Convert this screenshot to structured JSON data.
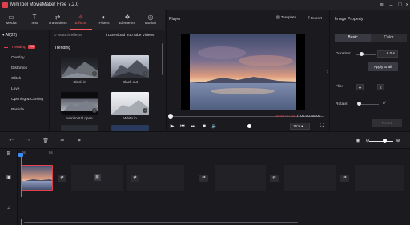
{
  "app": {
    "title": "MiniTool MovieMaker Free 7.2.0",
    "window_controls": [
      "menu-icon",
      "minimize-icon",
      "maximize-icon",
      "close-icon"
    ]
  },
  "toolbar": {
    "items": [
      {
        "label": "Media",
        "icon": "folder-icon"
      },
      {
        "label": "Text",
        "icon": "text-icon"
      },
      {
        "label": "Transitions",
        "icon": "transitions-icon"
      },
      {
        "label": "Effects",
        "icon": "effects-icon",
        "active": true
      },
      {
        "label": "Filters",
        "icon": "filters-icon"
      },
      {
        "label": "Elements",
        "icon": "elements-icon"
      },
      {
        "label": "Motion",
        "icon": "motion-icon"
      }
    ]
  },
  "effects": {
    "all_label": "All(22)",
    "search_placeholder": "Search effects",
    "download_label": "Download YouTube Videos",
    "categories": [
      {
        "label": "Trending",
        "badge": "Hot",
        "active": true
      },
      {
        "label": "Overlay"
      },
      {
        "label": "Distortion"
      },
      {
        "label": "Glitch"
      },
      {
        "label": "Love"
      },
      {
        "label": "Opening & Closing"
      },
      {
        "label": "Particle"
      }
    ],
    "section_title": "Trending",
    "tiles": [
      {
        "label": "Black in"
      },
      {
        "label": "Black out"
      },
      {
        "label": "Horizontal open"
      },
      {
        "label": "White in"
      },
      {
        "label": ""
      },
      {
        "label": ""
      }
    ]
  },
  "player": {
    "title": "Player",
    "template_label": "Template",
    "export_label": "Export",
    "current_time": "00:00:00.00",
    "separator": "/",
    "total_time": "00:00:05.00",
    "zoom": "16:9",
    "volume_level": 0.9
  },
  "property": {
    "title": "Image Property",
    "tabs": [
      "Basic",
      "Color"
    ],
    "duration_label": "Duration:",
    "duration_value": "6.0 s",
    "apply_all_label": "Apply to all",
    "flip_label": "Flip:",
    "rotate_label": "Rotate:",
    "rotate_value": "0°",
    "reset_label": "Reset"
  },
  "timeline": {
    "ruler": [
      "0s",
      "5s"
    ],
    "zoom_level": 0.55
  },
  "colors": {
    "accent": "#e0404a",
    "playhead": "#3a8dff",
    "background": "#1b1b1f"
  }
}
